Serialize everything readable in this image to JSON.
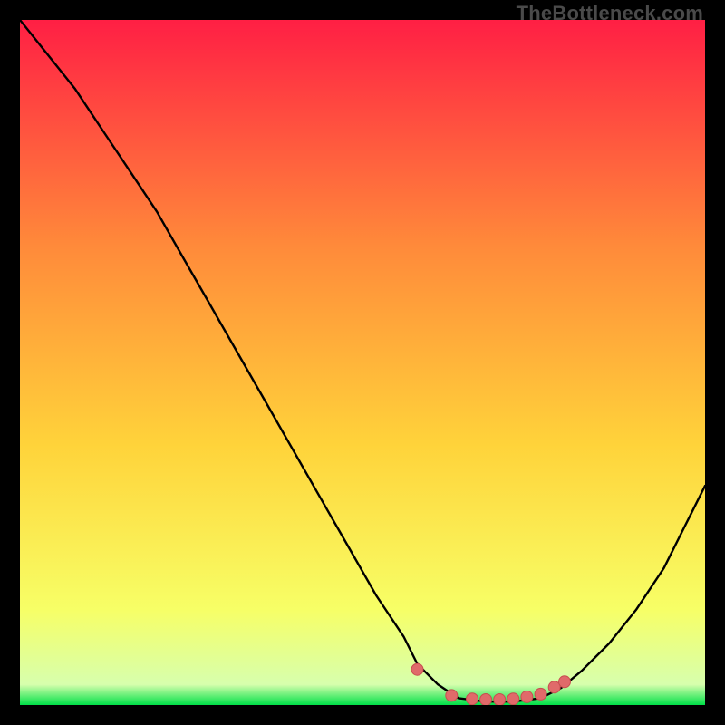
{
  "watermark": "TheBottleneck.com",
  "colors": {
    "frame": "#000000",
    "grad_top": "#ff1f44",
    "grad_mid1": "#ff6a3a",
    "grad_mid2": "#ffd33a",
    "grad_mid3": "#f7ff66",
    "grad_bottom": "#00e048",
    "curve": "#000000",
    "marker_fill": "#e06a6a",
    "marker_stroke": "#c74f4f"
  },
  "chart_data": {
    "type": "line",
    "title": "",
    "xlabel": "",
    "ylabel": "",
    "xlim": [
      0,
      100
    ],
    "ylim": [
      0,
      100
    ],
    "series": [
      {
        "name": "bottleneck-curve",
        "x": [
          0,
          4,
          8,
          12,
          16,
          20,
          24,
          28,
          32,
          36,
          40,
          44,
          48,
          52,
          56,
          58,
          61,
          64,
          68,
          72,
          76,
          79,
          82,
          86,
          90,
          94,
          97,
          100
        ],
        "y": [
          100,
          95,
          90,
          84,
          78,
          72,
          65,
          58,
          51,
          44,
          37,
          30,
          23,
          16,
          10,
          6,
          3,
          1,
          0.5,
          0.5,
          1,
          2.5,
          5,
          9,
          14,
          20,
          26,
          32
        ]
      }
    ],
    "markers": {
      "name": "highlight-points",
      "x": [
        58,
        63,
        66,
        68,
        70,
        72,
        74,
        76,
        78,
        79.5
      ],
      "y": [
        5.2,
        1.4,
        0.9,
        0.8,
        0.8,
        0.9,
        1.2,
        1.6,
        2.6,
        3.4
      ]
    }
  }
}
